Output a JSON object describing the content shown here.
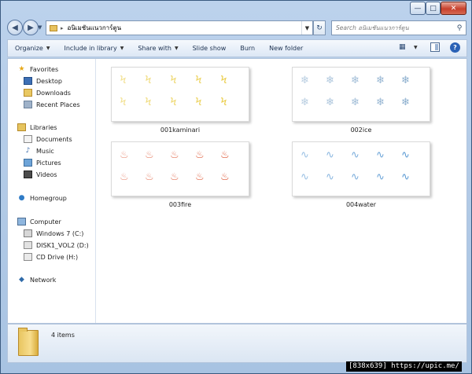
{
  "window": {
    "minimize_glyph": "—",
    "maximize_glyph": "□",
    "close_glyph": "✕"
  },
  "nav": {
    "back_glyph": "◀",
    "forward_glyph": "▶",
    "address_text": "อนิเมชันแนวการ์ตูน",
    "address_separator": "▸",
    "refresh_glyph": "↻",
    "search_placeholder": "Search อนิเมชันแนวการ์ตูน",
    "search_glyph": "⚲"
  },
  "toolbar": {
    "organize": "Organize",
    "include_in_library": "Include in library",
    "share_with": "Share with",
    "slide_show": "Slide show",
    "burn": "Burn",
    "new_folder": "New folder",
    "help": "?"
  },
  "navpane": {
    "favorites": "Favorites",
    "desktop": "Desktop",
    "downloads": "Downloads",
    "recent_places": "Recent Places",
    "libraries": "Libraries",
    "documents": "Documents",
    "music": "Music",
    "pictures": "Pictures",
    "videos": "Videos",
    "homegroup": "Homegroup",
    "computer": "Computer",
    "drive_c": "Windows 7 (C:)",
    "drive_d": "DISK1_VOL2 (D:)",
    "drive_h": "CD Drive (H:)",
    "network": "Network"
  },
  "folders": [
    {
      "name": "001kaminari",
      "sprite": "Ϟ",
      "color": "#e8c93a"
    },
    {
      "name": "002ice",
      "sprite": "❄",
      "color": "#7fa6c9"
    },
    {
      "name": "003fire",
      "sprite": "♨",
      "color": "#d9421c"
    },
    {
      "name": "004water",
      "sprite": "∿",
      "color": "#4a8fcf"
    }
  ],
  "status": {
    "item_count": "4 items"
  },
  "watermark": "[838x639] https://upic.me/"
}
